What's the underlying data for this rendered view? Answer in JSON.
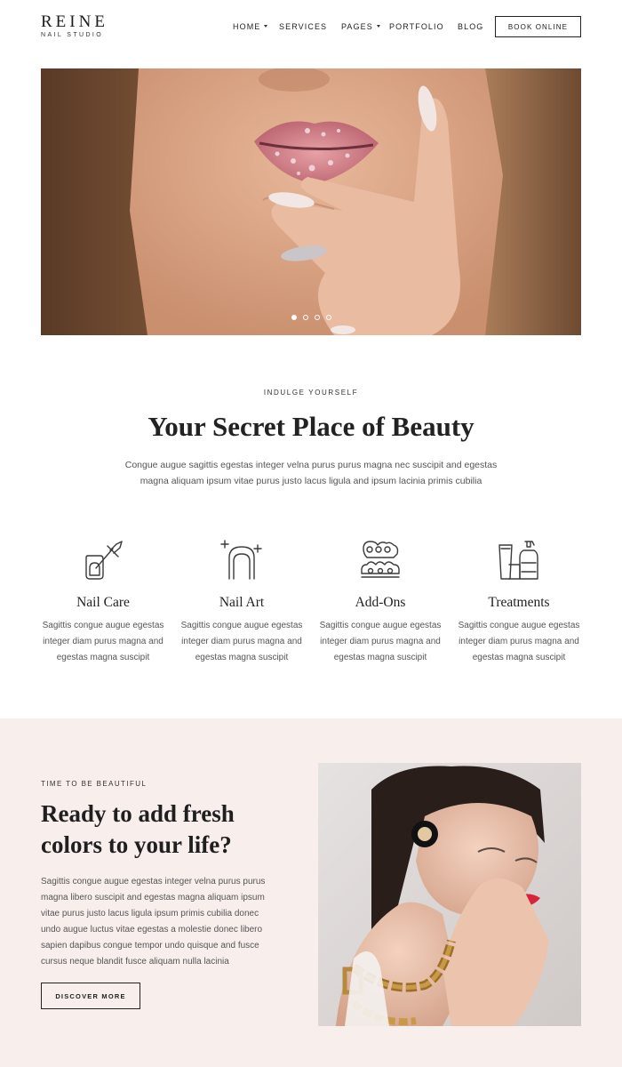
{
  "header": {
    "logo_main": "REINE",
    "logo_sub": "NAIL STUDIO",
    "nav": [
      {
        "label": "HOME",
        "has_dropdown": true
      },
      {
        "label": "SERVICES",
        "has_dropdown": false
      },
      {
        "label": "PAGES",
        "has_dropdown": true
      },
      {
        "label": "PORTFOLIO",
        "has_dropdown": false
      },
      {
        "label": "BLOG",
        "has_dropdown": false
      }
    ],
    "book_label": "BOOK ONLINE"
  },
  "hero": {
    "slides_total": 4,
    "active_slide": 1
  },
  "intro": {
    "eyebrow": "INDULGE YOURSELF",
    "title": "Your Secret Place of Beauty",
    "text": "Congue augue sagittis egestas integer velna purus purus magna nec suscipit and egestas magna aliquam ipsum vitae purus justo lacus ligula and ipsum lacinia primis cubilia"
  },
  "services": [
    {
      "icon": "nail-polish-icon",
      "title": "Nail Care",
      "text": "Sagittis congue augue egestas integer diam purus magna and egestas magna suscipit"
    },
    {
      "icon": "sparkle-nail-icon",
      "title": "Nail Art",
      "text": "Sagittis congue augue egestas integer diam purus magna and egestas magna suscipit"
    },
    {
      "icon": "toe-separator-icon",
      "title": "Add-Ons",
      "text": "Sagittis congue augue egestas integer diam purus magna and egestas magna suscipit"
    },
    {
      "icon": "cosmetic-bottles-icon",
      "title": "Treatments",
      "text": "Sagittis congue augue egestas integer diam purus magna and egestas magna suscipit"
    }
  ],
  "feature": {
    "eyebrow": "TIME TO BE BEAUTIFUL",
    "title": "Ready to add fresh colors to your life?",
    "text": "Sagittis congue augue egestas integer velna purus purus magna libero suscipit and egestas magna aliquam ipsum vitae purus justo lacus ligula ipsum primis cubilia donec undo augue luctus vitae egestas a molestie donec libero sapien dapibus congue tempor undo quisque and fusce cursus neque blandit fusce aliquam nulla lacinia",
    "button_label": "DISCOVER MORE"
  },
  "colors": {
    "band_background": "#f8eeec",
    "text_dark": "#222222",
    "text_body": "#555555",
    "icon_stroke": "#3a3a3a"
  }
}
